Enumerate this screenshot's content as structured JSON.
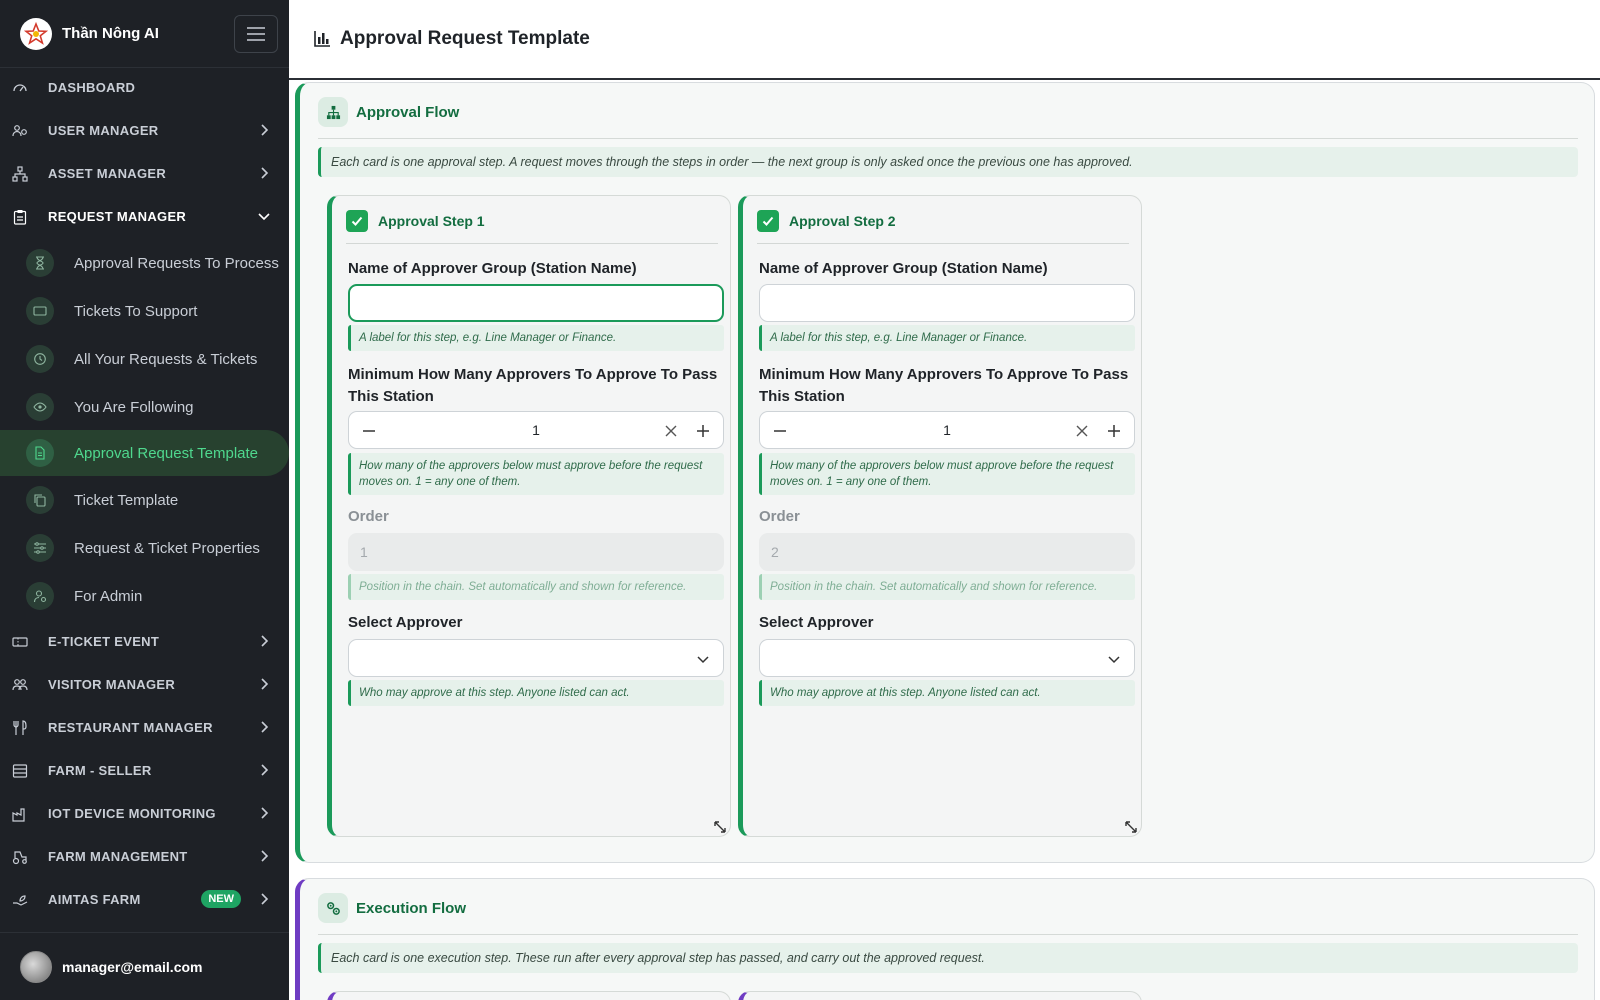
{
  "app": {
    "name": "Thần Nông AI",
    "user_email": "manager@email.com"
  },
  "sidebar": {
    "main_items": [
      {
        "label": "DASHBOARD",
        "icon": "gauge-icon"
      },
      {
        "label": "USER MANAGER",
        "icon": "users-gear-icon"
      },
      {
        "label": "ASSET MANAGER",
        "icon": "sitemap-icon"
      },
      {
        "label": "REQUEST MANAGER",
        "icon": "clipboard-icon"
      },
      {
        "label": "E-TICKET EVENT",
        "icon": "ticket-icon"
      },
      {
        "label": "VISITOR MANAGER",
        "icon": "visitors-icon"
      },
      {
        "label": "RESTAURANT MANAGER",
        "icon": "utensils-icon"
      },
      {
        "label": "FARM - SELLER",
        "icon": "store-icon"
      },
      {
        "label": "IOT DEVICE MONITORING",
        "icon": "factory-icon"
      },
      {
        "label": "FARM MANAGEMENT",
        "icon": "tractor-icon"
      },
      {
        "label": "AIMTAS FARM",
        "icon": "hand-plant-icon",
        "badge": "NEW"
      }
    ],
    "request_sub_items": [
      {
        "label": "Approval Requests To Process",
        "icon": "hourglass-icon"
      },
      {
        "label": "Tickets To Support",
        "icon": "ticket-icon"
      },
      {
        "label": "All Your Requests & Tickets",
        "icon": "history-icon"
      },
      {
        "label": "You Are Following",
        "icon": "eye-icon"
      },
      {
        "label": "Approval Request Template",
        "icon": "document-icon",
        "active": true
      },
      {
        "label": "Ticket Template",
        "icon": "copy-icon"
      },
      {
        "label": "Request & Ticket Properties",
        "icon": "sliders-icon"
      },
      {
        "label": "For Admin",
        "icon": "user-cog-icon"
      }
    ]
  },
  "page": {
    "title": "Approval Request Template"
  },
  "approval_flow": {
    "title": "Approval Flow",
    "note": "Each card is one approval step. A request moves through the steps in order — the next group is only asked once the previous one has approved.",
    "steps": [
      {
        "title": "Approval Step 1",
        "group_label": "Name of Approver Group (Station Name)",
        "group_value": "",
        "group_help": "A label for this step, e.g. Line Manager or Finance.",
        "min_label": "Minimum How Many Approvers To Approve To Pass This Station",
        "min_value": "1",
        "min_help": "How many of the approvers below must approve before the request moves on. 1 = any one of them.",
        "order_label": "Order",
        "order_value": "1",
        "order_help": "Position in the chain. Set automatically and shown for reference.",
        "approver_label": "Select Approver",
        "approver_value": "",
        "approver_help": "Who may approve at this step. Anyone listed can act."
      },
      {
        "title": "Approval Step 2",
        "group_label": "Name of Approver Group (Station Name)",
        "group_value": "",
        "group_help": "A label for this step, e.g. Line Manager or Finance.",
        "min_label": "Minimum How Many Approvers To Approve To Pass This Station",
        "min_value": "1",
        "min_help": "How many of the approvers below must approve before the request moves on. 1 = any one of them.",
        "order_label": "Order",
        "order_value": "2",
        "order_help": "Position in the chain. Set automatically and shown for reference.",
        "approver_label": "Select Approver",
        "approver_value": "",
        "approver_help": "Who may approve at this step. Anyone listed can act."
      }
    ]
  },
  "execution_flow": {
    "title": "Execution Flow",
    "note": "Each card is one execution step. These run after every approval step has passed, and carry out the approved request."
  },
  "colors": {
    "accent": "#1b9a5a",
    "sidebar_bg": "#1e2126",
    "exec_accent": "#6f3cc3",
    "badge": "#1fa463"
  }
}
